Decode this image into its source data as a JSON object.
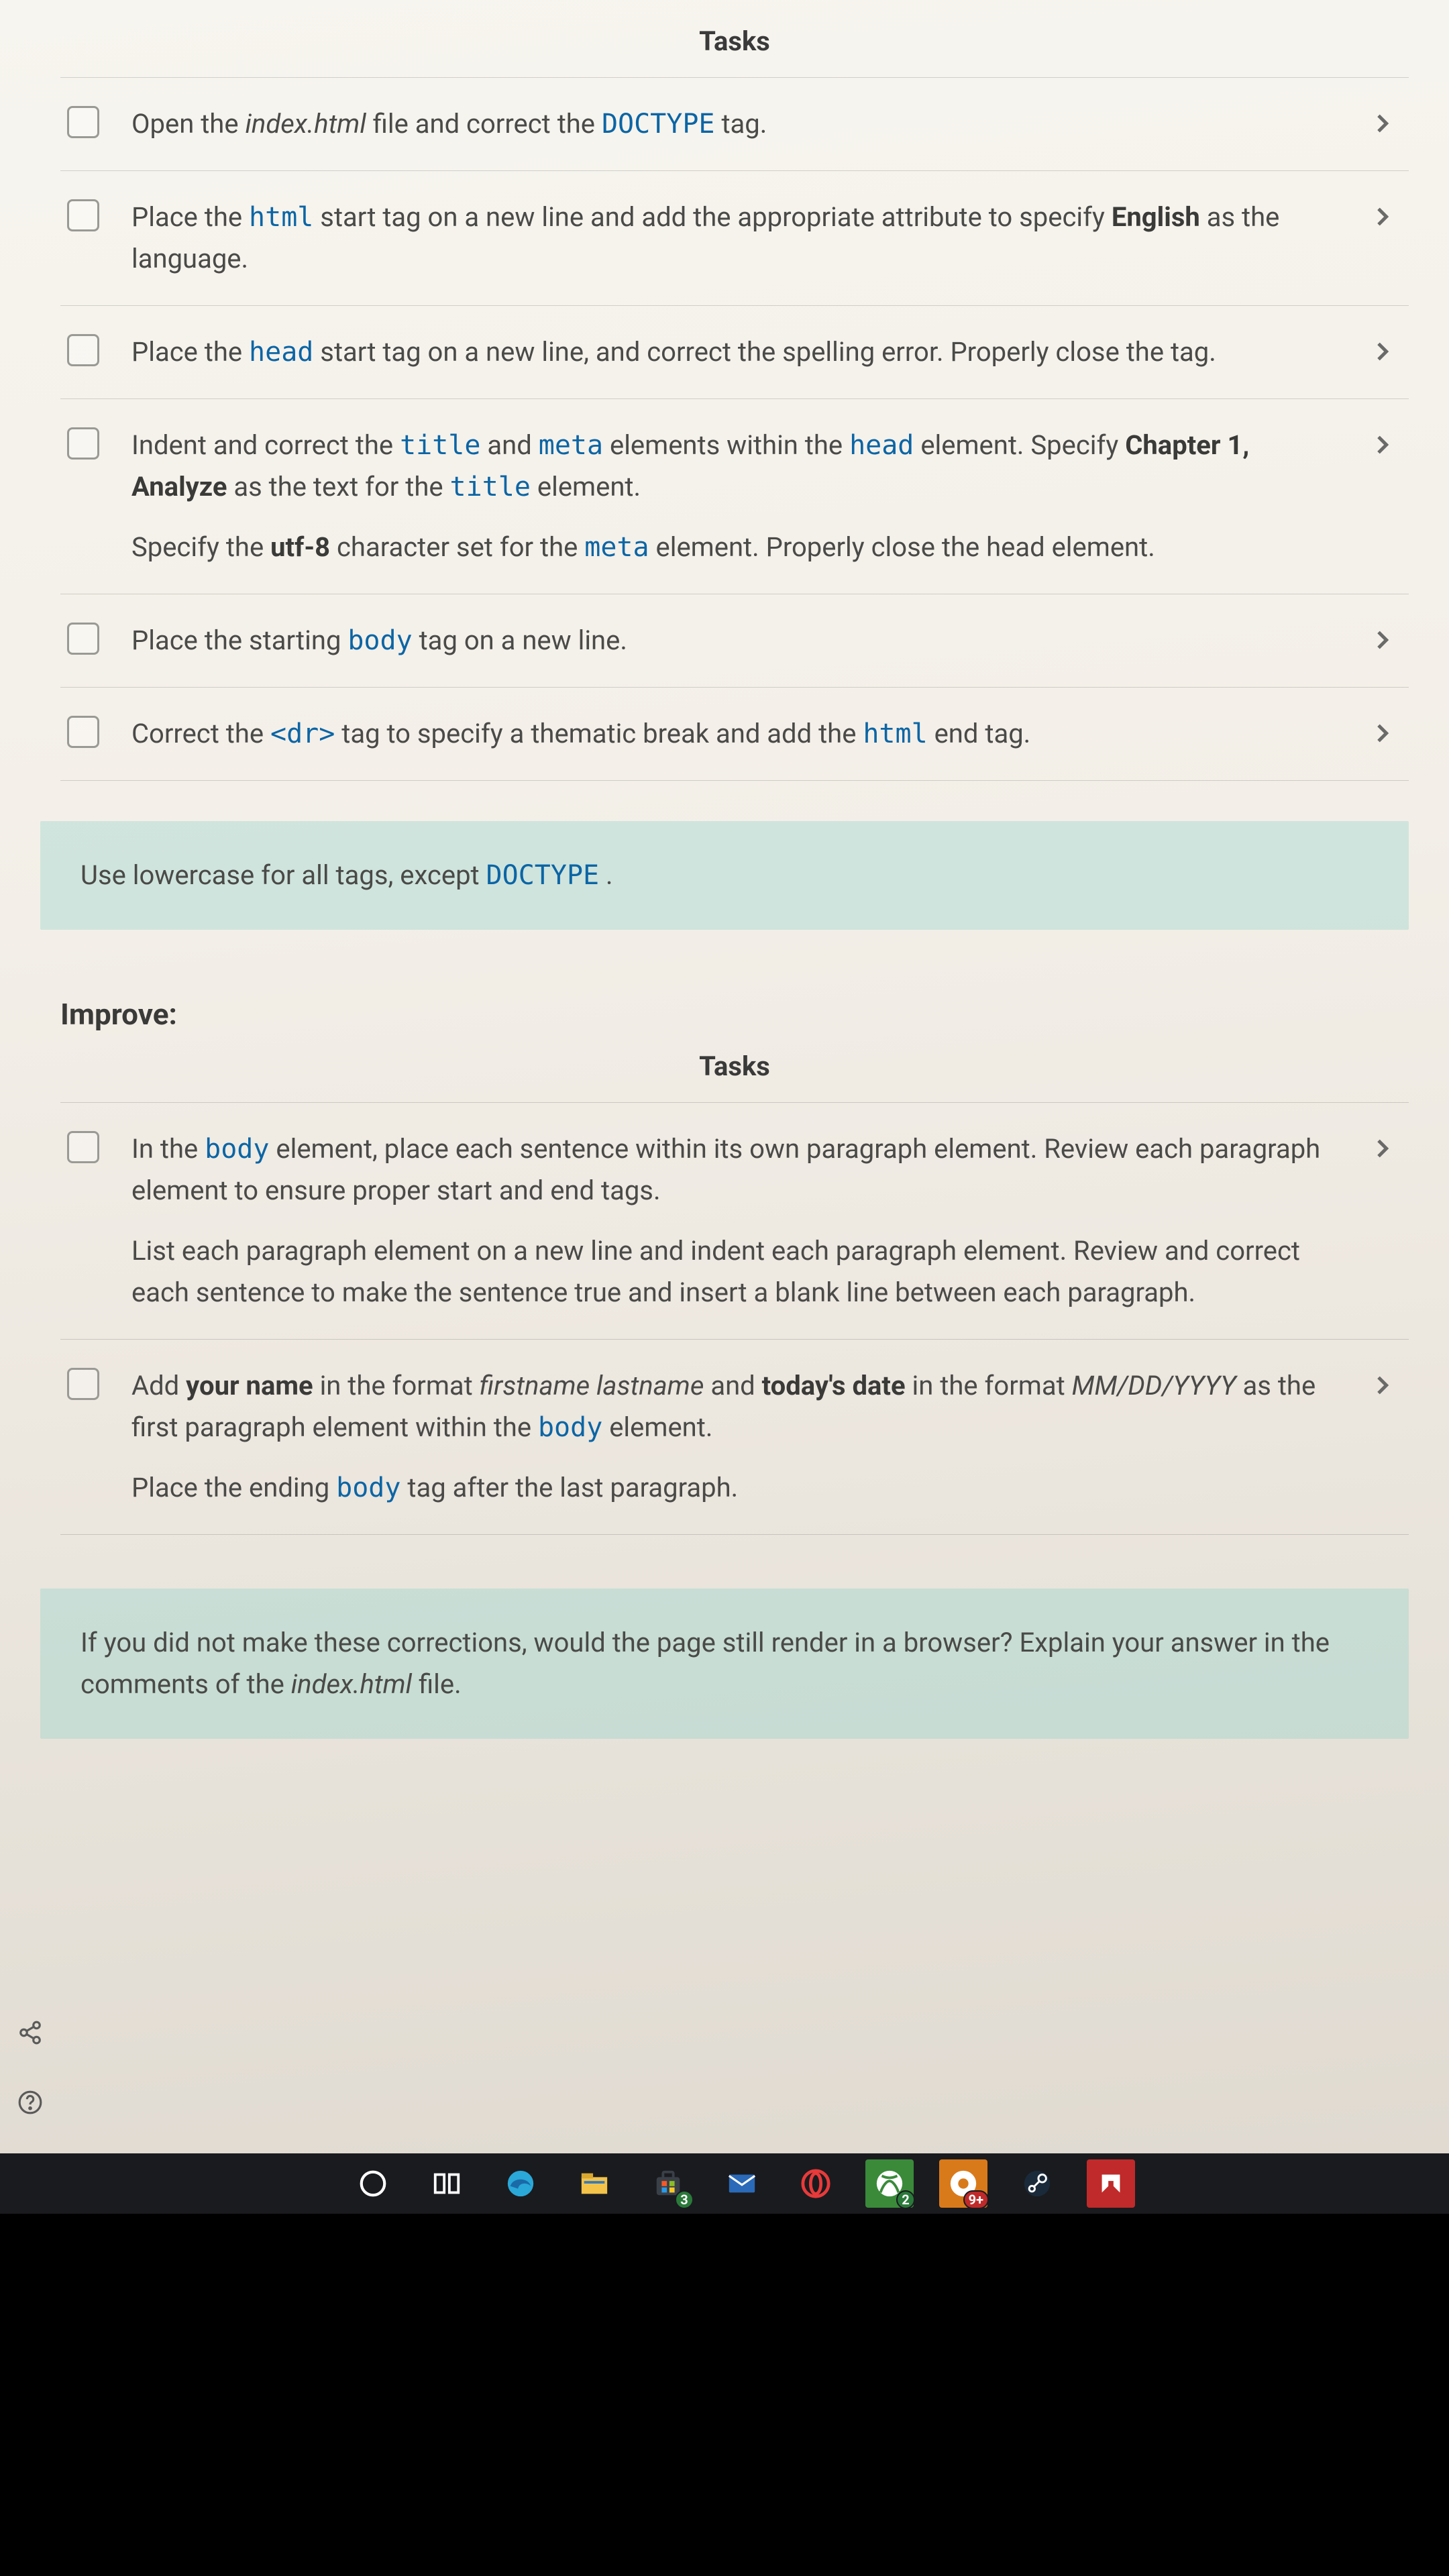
{
  "headers": {
    "tasks1": "Tasks",
    "tasks2": "Tasks"
  },
  "section_improve": "Improve:",
  "tasks1": [
    {
      "paras": [
        [
          {
            "t": "Open the "
          },
          {
            "t": "index.html",
            "cls": "italic"
          },
          {
            "t": " file and correct the "
          },
          {
            "t": "DOCTYPE",
            "cls": "code"
          },
          {
            "t": " tag."
          }
        ]
      ]
    },
    {
      "paras": [
        [
          {
            "t": "Place the "
          },
          {
            "t": "html",
            "cls": "code"
          },
          {
            "t": " start tag on a new line and add the appropriate attribute to specify "
          },
          {
            "t": "English",
            "cls": "bold"
          },
          {
            "t": " as the language."
          }
        ]
      ]
    },
    {
      "paras": [
        [
          {
            "t": "Place the "
          },
          {
            "t": "head",
            "cls": "code"
          },
          {
            "t": " start tag on a new line, and correct the spelling error. Properly close the tag."
          }
        ]
      ]
    },
    {
      "paras": [
        [
          {
            "t": "Indent and correct the "
          },
          {
            "t": "title",
            "cls": "code"
          },
          {
            "t": " and "
          },
          {
            "t": "meta",
            "cls": "code"
          },
          {
            "t": " elements within the "
          },
          {
            "t": "head",
            "cls": "code"
          },
          {
            "t": " element. Specify "
          },
          {
            "t": "Chapter 1, Analyze",
            "cls": "bold"
          },
          {
            "t": " as the text for the "
          },
          {
            "t": "title",
            "cls": "code"
          },
          {
            "t": " element."
          }
        ],
        [
          {
            "t": "Specify the "
          },
          {
            "t": "utf-8",
            "cls": "bold"
          },
          {
            "t": " character set for the "
          },
          {
            "t": "meta",
            "cls": "code"
          },
          {
            "t": " element. Properly close the head element."
          }
        ]
      ]
    },
    {
      "paras": [
        [
          {
            "t": "Place the starting "
          },
          {
            "t": "body",
            "cls": "code"
          },
          {
            "t": " tag on a new line."
          }
        ]
      ]
    },
    {
      "paras": [
        [
          {
            "t": "Correct the "
          },
          {
            "t": "<dr>",
            "cls": "code"
          },
          {
            "t": " tag to specify a thematic break and add the "
          },
          {
            "t": "html",
            "cls": "code"
          },
          {
            "t": " end tag."
          }
        ]
      ]
    }
  ],
  "note1": [
    {
      "t": "Use lowercase for all tags, except "
    },
    {
      "t": "DOCTYPE",
      "cls": "code"
    },
    {
      "t": " ."
    }
  ],
  "tasks2": [
    {
      "paras": [
        [
          {
            "t": "In the "
          },
          {
            "t": "body",
            "cls": "code"
          },
          {
            "t": " element, place each sentence within its own paragraph element. Review each paragraph element to ensure proper start and end tags."
          }
        ],
        [
          {
            "t": "List each paragraph element on a new line and indent each paragraph element. Review and correct each sentence to make the sentence true and insert a blank line between each paragraph."
          }
        ]
      ]
    },
    {
      "paras": [
        [
          {
            "t": "Add "
          },
          {
            "t": "your name",
            "cls": "bold"
          },
          {
            "t": " in the format "
          },
          {
            "t": "firstname lastname",
            "cls": "italic"
          },
          {
            "t": " and "
          },
          {
            "t": "today's date",
            "cls": "bold"
          },
          {
            "t": " in the format "
          },
          {
            "t": "MM/DD/YYYY",
            "cls": "italic"
          },
          {
            "t": " as the first paragraph element within the "
          },
          {
            "t": "body",
            "cls": "code"
          },
          {
            "t": " element."
          }
        ],
        [
          {
            "t": "Place the ending "
          },
          {
            "t": "body",
            "cls": "code"
          },
          {
            "t": " tag after the last paragraph."
          }
        ]
      ]
    }
  ],
  "note2": [
    {
      "t": "If you did not make these corrections, would the page still render in a browser? Explain your answer in the comments of the "
    },
    {
      "t": "index.html",
      "cls": "italic"
    },
    {
      "t": " file."
    }
  ],
  "side_rail": [
    "share-icon",
    "help-icon",
    "settings-icon"
  ],
  "taskbar": {
    "items": [
      {
        "name": "cortana-icon",
        "bg": "transparent"
      },
      {
        "name": "task-view-icon",
        "bg": "transparent"
      },
      {
        "name": "edge-icon",
        "bg": "transparent"
      },
      {
        "name": "file-explorer-icon",
        "bg": "transparent"
      },
      {
        "name": "microsoft-store-icon",
        "bg": "transparent",
        "badge": "3",
        "badge_cls": "badge"
      },
      {
        "name": "mail-icon",
        "bg": "transparent"
      },
      {
        "name": "opera-icon",
        "bg": "transparent"
      },
      {
        "name": "xbox-icon",
        "bg": "#3a8a3a",
        "badge": "2",
        "badge_cls": "badge"
      },
      {
        "name": "groove-icon",
        "bg": "#d97a1a",
        "badge": "9+",
        "badge_cls": "badge red"
      },
      {
        "name": "steam-icon",
        "bg": "transparent"
      },
      {
        "name": "amd-icon",
        "bg": "#c02a2a"
      }
    ]
  }
}
